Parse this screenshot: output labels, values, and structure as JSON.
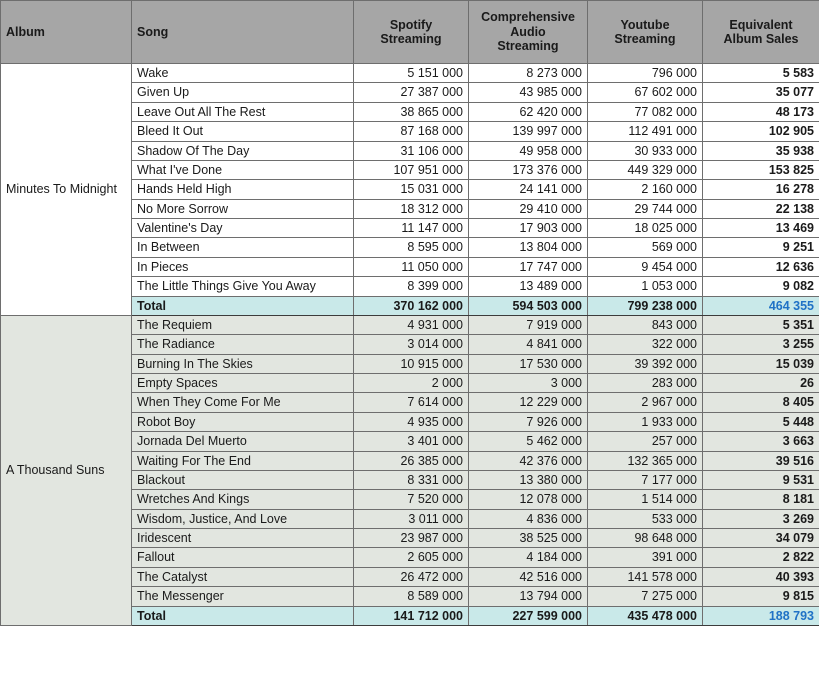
{
  "table": {
    "columns": [
      {
        "key": "album",
        "label": "Album",
        "label_lines": [
          "Album"
        ],
        "align": "left"
      },
      {
        "key": "song",
        "label": "Song",
        "label_lines": [
          "Song"
        ],
        "align": "left"
      },
      {
        "key": "spotify",
        "label": "Spotify Streaming",
        "label_lines": [
          "Spotify",
          "Streaming"
        ],
        "align": "center"
      },
      {
        "key": "cas",
        "label": "Comprehensive Audio Streaming",
        "label_lines": [
          "Comprehensive",
          "Audio",
          "Streaming"
        ],
        "align": "center"
      },
      {
        "key": "youtube",
        "label": "Youtube Streaming",
        "label_lines": [
          "Youtube",
          "Streaming"
        ],
        "align": "center"
      },
      {
        "key": "eas",
        "label": "Equivalent Album Sales",
        "label_lines": [
          "Equivalent",
          "Album Sales"
        ],
        "align": "center"
      }
    ],
    "total_label": "Total",
    "albums": [
      {
        "name": "Minutes To Midnight",
        "band": "a",
        "tracks": [
          {
            "song": "Wake",
            "spotify": "5 151 000",
            "cas": "8 273 000",
            "youtube": "796 000",
            "eas": "5 583"
          },
          {
            "song": "Given Up",
            "spotify": "27 387 000",
            "cas": "43 985 000",
            "youtube": "67 602 000",
            "eas": "35 077"
          },
          {
            "song": "Leave Out All The Rest",
            "spotify": "38 865 000",
            "cas": "62 420 000",
            "youtube": "77 082 000",
            "eas": "48 173"
          },
          {
            "song": "Bleed It Out",
            "spotify": "87 168 000",
            "cas": "139 997 000",
            "youtube": "112 491 000",
            "eas": "102 905"
          },
          {
            "song": "Shadow Of The Day",
            "spotify": "31 106 000",
            "cas": "49 958 000",
            "youtube": "30 933 000",
            "eas": "35 938"
          },
          {
            "song": "What I've Done",
            "spotify": "107 951 000",
            "cas": "173 376 000",
            "youtube": "449 329 000",
            "eas": "153 825"
          },
          {
            "song": "Hands Held High",
            "spotify": "15 031 000",
            "cas": "24 141 000",
            "youtube": "2 160 000",
            "eas": "16 278"
          },
          {
            "song": "No More Sorrow",
            "spotify": "18 312 000",
            "cas": "29 410 000",
            "youtube": "29 744 000",
            "eas": "22 138"
          },
          {
            "song": "Valentine's Day",
            "spotify": "11 147 000",
            "cas": "17 903 000",
            "youtube": "18 025 000",
            "eas": "13 469"
          },
          {
            "song": "In Between",
            "spotify": "8 595 000",
            "cas": "13 804 000",
            "youtube": "569 000",
            "eas": "9 251"
          },
          {
            "song": "In Pieces",
            "spotify": "11 050 000",
            "cas": "17 747 000",
            "youtube": "9 454 000",
            "eas": "12 636"
          },
          {
            "song": "The Little Things Give You Away",
            "spotify": "8 399 000",
            "cas": "13 489 000",
            "youtube": "1 053 000",
            "eas": "9 082"
          }
        ],
        "total": {
          "song": "Total",
          "spotify": "370 162 000",
          "cas": "594 503 000",
          "youtube": "799 238 000",
          "eas": "464 355"
        }
      },
      {
        "name": "A Thousand Suns",
        "band": "b",
        "tracks": [
          {
            "song": "The Requiem",
            "spotify": "4 931 000",
            "cas": "7 919 000",
            "youtube": "843 000",
            "eas": "5 351"
          },
          {
            "song": "The Radiance",
            "spotify": "3 014 000",
            "cas": "4 841 000",
            "youtube": "322 000",
            "eas": "3 255"
          },
          {
            "song": "Burning In The Skies",
            "spotify": "10 915 000",
            "cas": "17 530 000",
            "youtube": "39 392 000",
            "eas": "15 039"
          },
          {
            "song": "Empty Spaces",
            "spotify": "2 000",
            "cas": "3 000",
            "youtube": "283 000",
            "eas": "26"
          },
          {
            "song": "When They Come For Me",
            "spotify": "7 614 000",
            "cas": "12 229 000",
            "youtube": "2 967 000",
            "eas": "8 405"
          },
          {
            "song": "Robot Boy",
            "spotify": "4 935 000",
            "cas": "7 926 000",
            "youtube": "1 933 000",
            "eas": "5 448"
          },
          {
            "song": "Jornada Del Muerto",
            "spotify": "3 401 000",
            "cas": "5 462 000",
            "youtube": "257 000",
            "eas": "3 663"
          },
          {
            "song": "Waiting For The End",
            "spotify": "26 385 000",
            "cas": "42 376 000",
            "youtube": "132 365 000",
            "eas": "39 516"
          },
          {
            "song": "Blackout",
            "spotify": "8 331 000",
            "cas": "13 380 000",
            "youtube": "7 177 000",
            "eas": "9 531"
          },
          {
            "song": "Wretches And Kings",
            "spotify": "7 520 000",
            "cas": "12 078 000",
            "youtube": "1 514 000",
            "eas": "8 181"
          },
          {
            "song": "Wisdom, Justice, And Love",
            "spotify": "3 011 000",
            "cas": "4 836 000",
            "youtube": "533 000",
            "eas": "3 269"
          },
          {
            "song": "Iridescent",
            "spotify": "23 987 000",
            "cas": "38 525 000",
            "youtube": "98 648 000",
            "eas": "34 079"
          },
          {
            "song": "Fallout",
            "spotify": "2 605 000",
            "cas": "4 184 000",
            "youtube": "391 000",
            "eas": "2 822"
          },
          {
            "song": "The Catalyst",
            "spotify": "26 472 000",
            "cas": "42 516 000",
            "youtube": "141 578 000",
            "eas": "40 393"
          },
          {
            "song": "The Messenger",
            "spotify": "8 589 000",
            "cas": "13 794 000",
            "youtube": "7 275 000",
            "eas": "9 815"
          }
        ],
        "total": {
          "song": "Total",
          "spotify": "141 712 000",
          "cas": "227 599 000",
          "youtube": "435 478 000",
          "eas": "188 793"
        }
      }
    ]
  },
  "colors": {
    "header_bg": "#a6a6a6",
    "band_a_bg": "#ffffff",
    "band_b_bg": "#e2e6e0",
    "total_bg": "#c9e9e9",
    "total_eas_text": "#2072c6",
    "grid": "#6e6e6e"
  }
}
